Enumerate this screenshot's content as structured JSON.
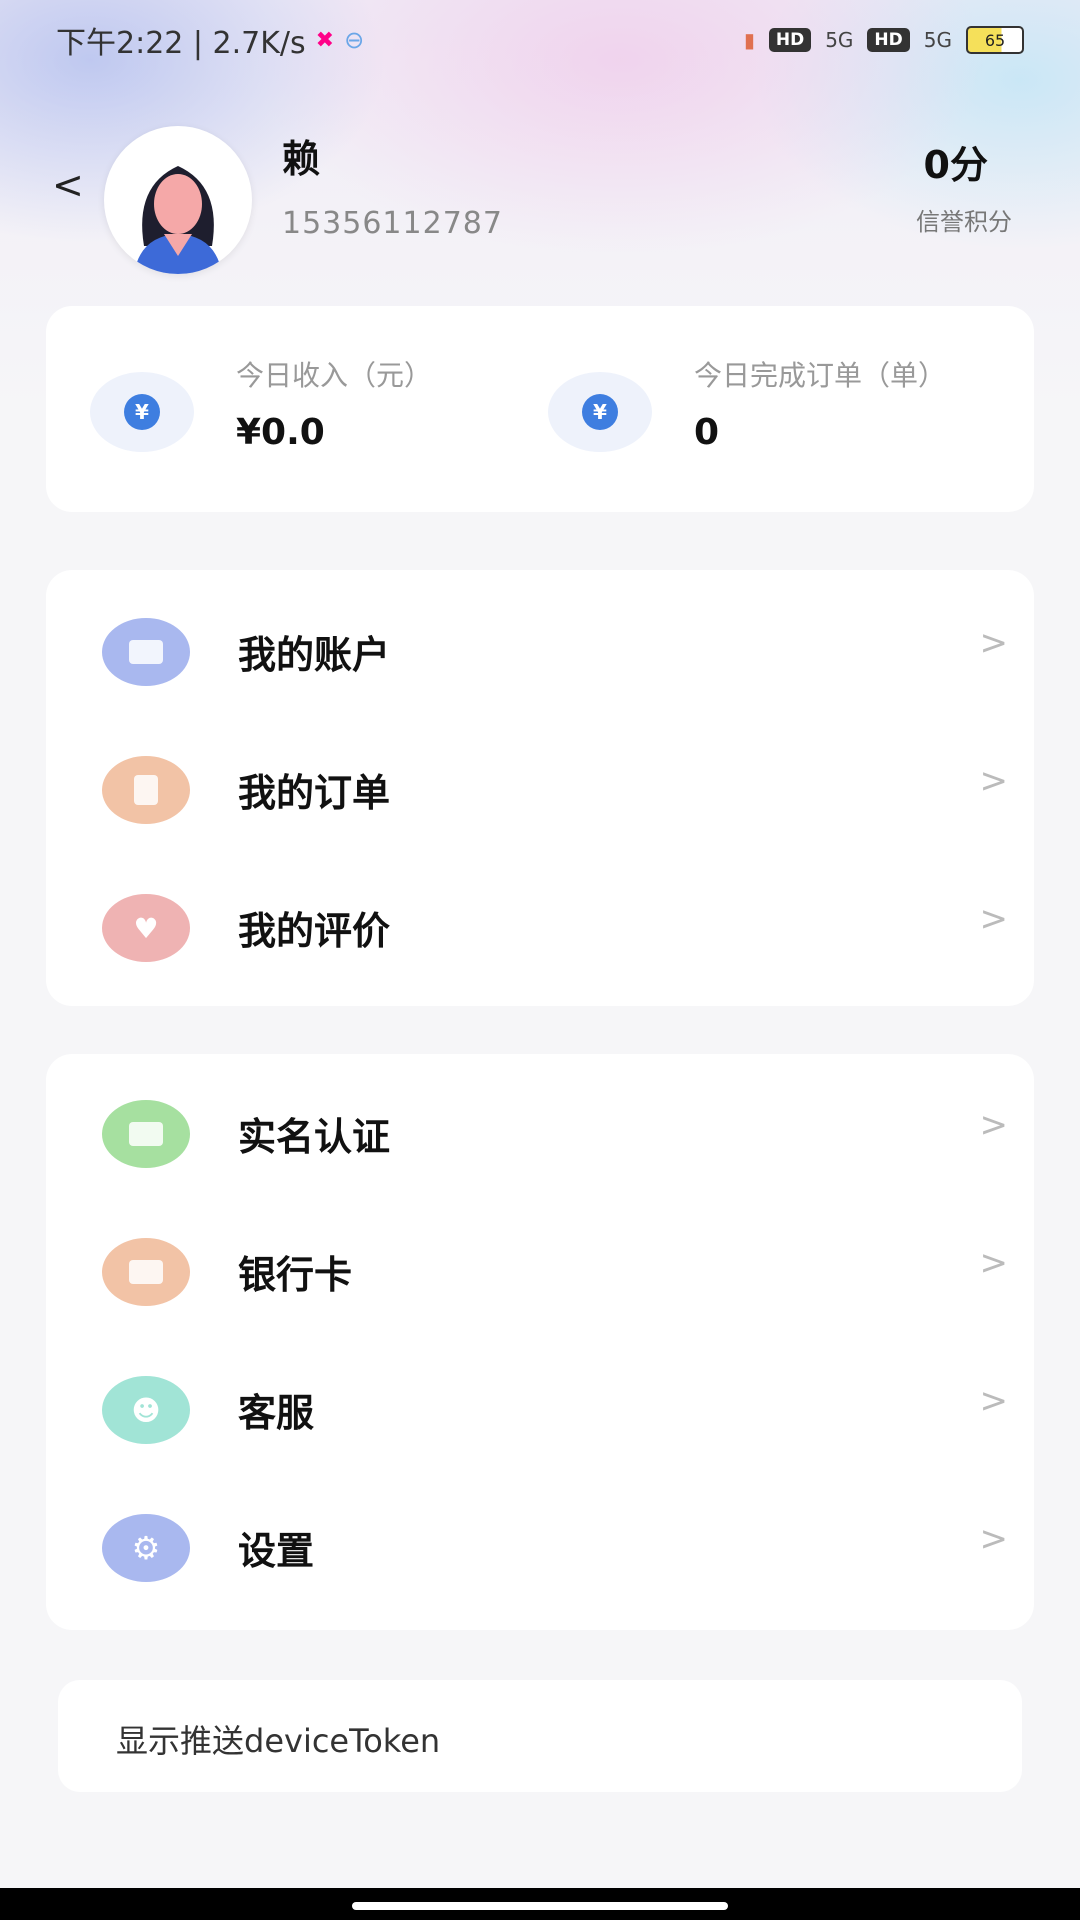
{
  "status_bar": {
    "time_speed": "下午2:22 | 2.7K/s",
    "network_1": "5G",
    "network_2": "5G",
    "hd_1": "HD",
    "hd_2": "HD",
    "battery": "65"
  },
  "profile": {
    "name": "赖",
    "phone": "15356112787",
    "score_value": "0分",
    "score_label": "信誉积分"
  },
  "stats": [
    {
      "label": "今日收入（元）",
      "value": "¥0.0",
      "icon": "money-bag-icon"
    },
    {
      "label": "今日完成订单（单）",
      "value": "0",
      "icon": "money-bag-icon"
    }
  ],
  "menu_group_1": [
    {
      "label": "我的账户",
      "icon": "account-card-icon",
      "color": "#a9b8ef"
    },
    {
      "label": "我的订单",
      "icon": "order-clipboard-icon",
      "color": "#f2c3a6"
    },
    {
      "label": "我的评价",
      "icon": "review-heart-icon",
      "color": "#efb3b3"
    }
  ],
  "menu_group_2": [
    {
      "label": "实名认证",
      "icon": "id-card-icon",
      "color": "#a6e0a0"
    },
    {
      "label": "银行卡",
      "icon": "bank-card-icon",
      "color": "#f2c3a6"
    },
    {
      "label": "客服",
      "icon": "customer-service-icon",
      "color": "#a1e4d6"
    },
    {
      "label": "设置",
      "icon": "settings-gear-icon",
      "color": "#a9b8ef"
    }
  ],
  "chevron_glyph": ">",
  "back_glyph": "<",
  "token_label": "显示推送deviceToken"
}
